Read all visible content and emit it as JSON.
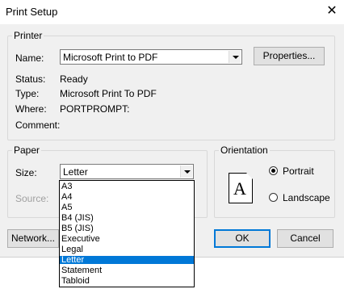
{
  "window": {
    "title": "Print Setup",
    "close_glyph": "✕"
  },
  "printer": {
    "legend": "Printer",
    "name_label": "Name:",
    "name_value": "Microsoft Print to PDF",
    "properties_button": "Properties...",
    "status_label": "Status:",
    "status_value": "Ready",
    "type_label": "Type:",
    "type_value": "Microsoft Print To PDF",
    "where_label": "Where:",
    "where_value": "PORTPROMPT:",
    "comment_label": "Comment:",
    "comment_value": ""
  },
  "paper": {
    "legend": "Paper",
    "size_label": "Size:",
    "size_value": "Letter",
    "source_label": "Source:",
    "size_options": [
      "A3",
      "A4",
      "A5",
      "B4 (JIS)",
      "B5 (JIS)",
      "Executive",
      "Legal",
      "Letter",
      "Statement",
      "Tabloid"
    ],
    "selected_index": 7
  },
  "orientation": {
    "legend": "Orientation",
    "icon_letter": "A",
    "portrait_label": "Portrait",
    "landscape_label": "Landscape",
    "selected": "Portrait"
  },
  "buttons": {
    "network": "Network...",
    "ok": "OK",
    "cancel": "Cancel"
  },
  "colors": {
    "selection": "#0078d7",
    "dialog_bg": "#f0f0f0"
  }
}
